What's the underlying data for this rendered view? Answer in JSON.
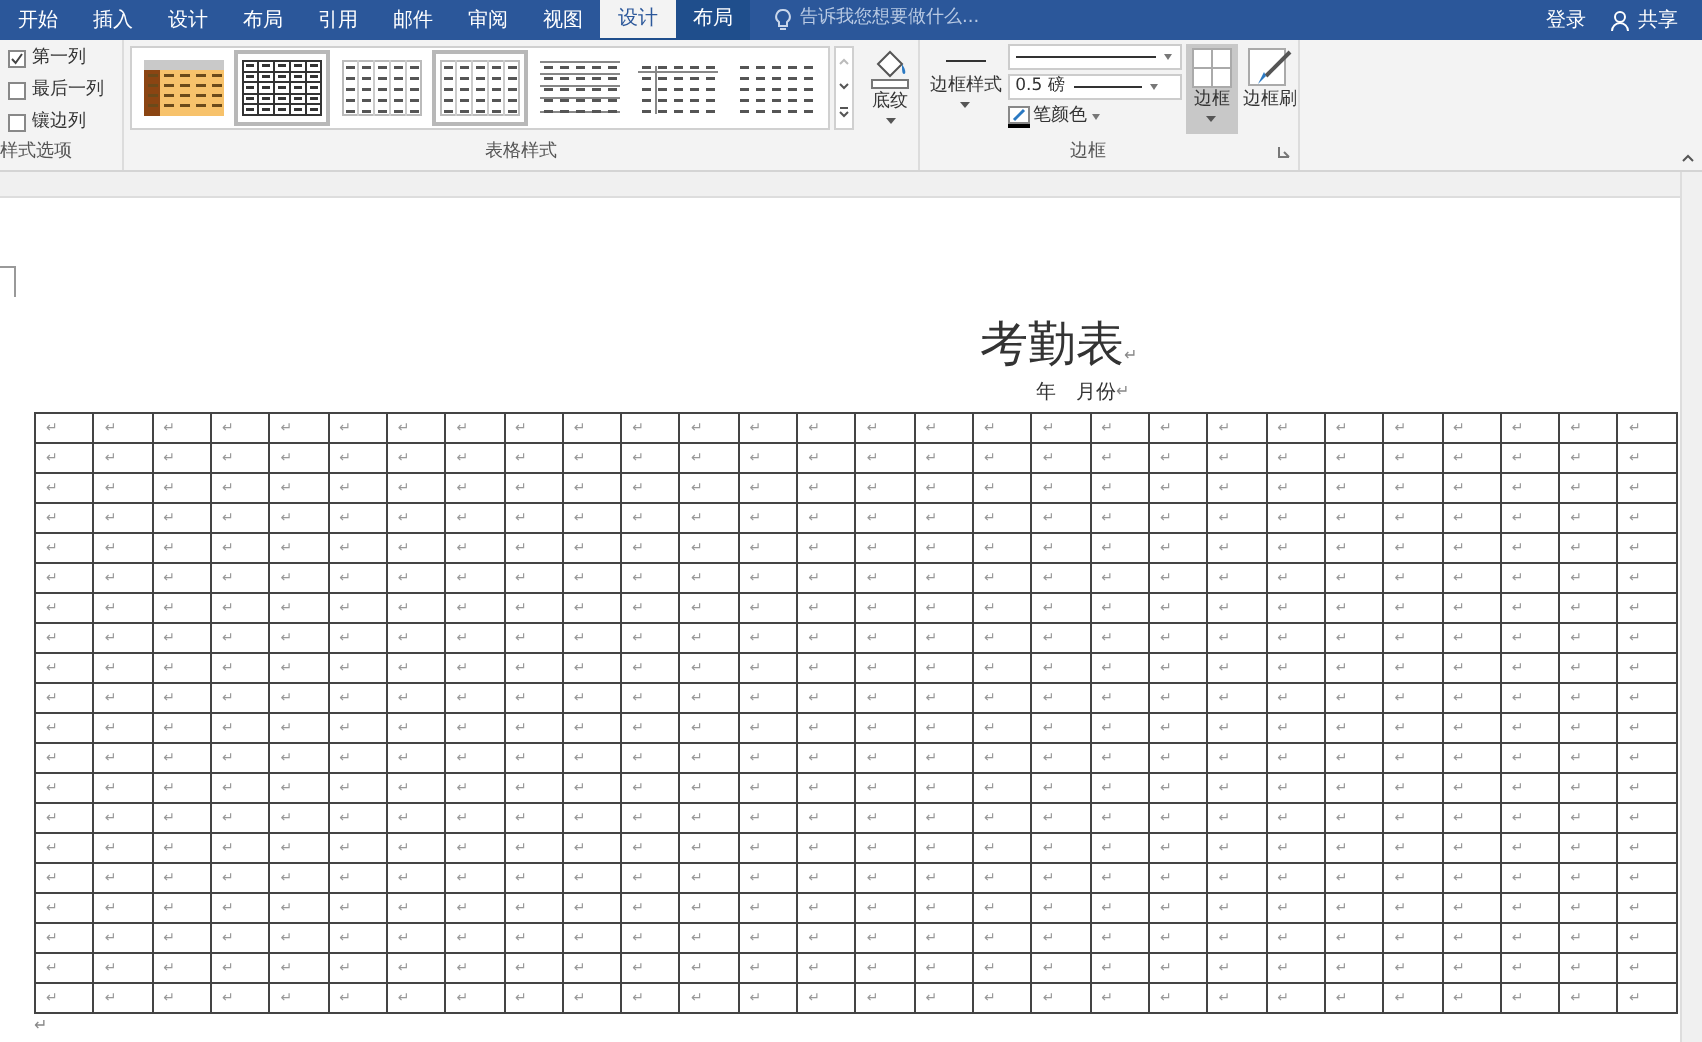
{
  "tabs": [
    {
      "label": "开始",
      "selected": false,
      "kind": "main"
    },
    {
      "label": "插入",
      "selected": false,
      "kind": "main"
    },
    {
      "label": "设计",
      "selected": false,
      "kind": "main"
    },
    {
      "label": "布局",
      "selected": false,
      "kind": "main"
    },
    {
      "label": "引用",
      "selected": false,
      "kind": "main"
    },
    {
      "label": "邮件",
      "selected": false,
      "kind": "main"
    },
    {
      "label": "审阅",
      "selected": false,
      "kind": "main"
    },
    {
      "label": "视图",
      "selected": false,
      "kind": "main"
    },
    {
      "label": "设计",
      "selected": true,
      "kind": "context"
    },
    {
      "label": "布局",
      "selected": false,
      "kind": "context"
    }
  ],
  "search": {
    "placeholder": "告诉我您想要做什么..."
  },
  "account": {
    "sign_in": "登录",
    "share": "共享"
  },
  "ribbon": {
    "options": {
      "items": [
        {
          "label": "第一列",
          "checked": true
        },
        {
          "label": "最后一列",
          "checked": false
        },
        {
          "label": "镶边列",
          "checked": false
        }
      ],
      "group_label": "样式选项"
    },
    "styles": {
      "items": [
        {
          "kind": "colored",
          "selected": false
        },
        {
          "kind": "grid",
          "selected": true
        },
        {
          "kind": "plain",
          "selected": false
        },
        {
          "kind": "plain",
          "selected": true
        },
        {
          "kind": "lines",
          "selected": false
        },
        {
          "kind": "split",
          "selected": false
        },
        {
          "kind": "dashes",
          "selected": false
        }
      ],
      "shading": "底纹",
      "group_label": "表格样式"
    },
    "borders": {
      "border_styles": "边框样式",
      "line_weight": "0.5 磅",
      "pen_color": "笔颜色",
      "border_button": {
        "label": "边框",
        "selected": true
      },
      "border_painter": "边框刷",
      "group_label": "边框"
    }
  },
  "document": {
    "title": "考勤表",
    "title_mark": "↵",
    "subtitle": "年　月份",
    "subtitle_mark": "↵",
    "end_mark": "↵",
    "table": {
      "rows": [
        [
          "↵",
          "↵",
          "↵",
          "↵",
          "↵",
          "↵",
          "↵",
          "↵",
          "↵",
          "↵",
          "↵",
          "↵",
          "↵",
          "↵",
          "↵",
          "↵",
          "↵",
          "↵",
          "↵",
          "↵",
          "↵",
          "↵",
          "↵",
          "↵",
          "↵",
          "↵",
          "↵",
          "↵"
        ],
        [
          "↵",
          "↵",
          "↵",
          "↵",
          "↵",
          "↵",
          "↵",
          "↵",
          "↵",
          "↵",
          "↵",
          "↵",
          "↵",
          "↵",
          "↵",
          "↵",
          "↵",
          "↵",
          "↵",
          "↵",
          "↵",
          "↵",
          "↵",
          "↵",
          "↵",
          "↵",
          "↵",
          "↵"
        ],
        [
          "↵",
          "↵",
          "↵",
          "↵",
          "↵",
          "↵",
          "↵",
          "↵",
          "↵",
          "↵",
          "↵",
          "↵",
          "↵",
          "↵",
          "↵",
          "↵",
          "↵",
          "↵",
          "↵",
          "↵",
          "↵",
          "↵",
          "↵",
          "↵",
          "↵",
          "↵",
          "↵",
          "↵"
        ],
        [
          "↵",
          "↵",
          "↵",
          "↵",
          "↵",
          "↵",
          "↵",
          "↵",
          "↵",
          "↵",
          "↵",
          "↵",
          "↵",
          "↵",
          "↵",
          "↵",
          "↵",
          "↵",
          "↵",
          "↵",
          "↵",
          "↵",
          "↵",
          "↵",
          "↵",
          "↵",
          "↵",
          "↵"
        ],
        [
          "↵",
          "↵",
          "↵",
          "↵",
          "↵",
          "↵",
          "↵",
          "↵",
          "↵",
          "↵",
          "↵",
          "↵",
          "↵",
          "↵",
          "↵",
          "↵",
          "↵",
          "↵",
          "↵",
          "↵",
          "↵",
          "↵",
          "↵",
          "↵",
          "↵",
          "↵",
          "↵",
          "↵"
        ],
        [
          "↵",
          "↵",
          "↵",
          "↵",
          "↵",
          "↵",
          "↵",
          "↵",
          "↵",
          "↵",
          "↵",
          "↵",
          "↵",
          "↵",
          "↵",
          "↵",
          "↵",
          "↵",
          "↵",
          "↵",
          "↵",
          "↵",
          "↵",
          "↵",
          "↵",
          "↵",
          "↵",
          "↵"
        ],
        [
          "↵",
          "↵",
          "↵",
          "↵",
          "↵",
          "↵",
          "↵",
          "↵",
          "↵",
          "↵",
          "↵",
          "↵",
          "↵",
          "↵",
          "↵",
          "↵",
          "↵",
          "↵",
          "↵",
          "↵",
          "↵",
          "↵",
          "↵",
          "↵",
          "↵",
          "↵",
          "↵",
          "↵"
        ],
        [
          "↵",
          "↵",
          "↵",
          "↵",
          "↵",
          "↵",
          "↵",
          "↵",
          "↵",
          "↵",
          "↵",
          "↵",
          "↵",
          "↵",
          "↵",
          "↵",
          "↵",
          "↵",
          "↵",
          "↵",
          "↵",
          "↵",
          "↵",
          "↵",
          "↵",
          "↵",
          "↵",
          "↵"
        ],
        [
          "↵",
          "↵",
          "↵",
          "↵",
          "↵",
          "↵",
          "↵",
          "↵",
          "↵",
          "↵",
          "↵",
          "↵",
          "↵",
          "↵",
          "↵",
          "↵",
          "↵",
          "↵",
          "↵",
          "↵",
          "↵",
          "↵",
          "↵",
          "↵",
          "↵",
          "↵",
          "↵",
          "↵"
        ],
        [
          "↵",
          "↵",
          "↵",
          "↵",
          "↵",
          "↵",
          "↵",
          "↵",
          "↵",
          "↵",
          "↵",
          "↵",
          "↵",
          "↵",
          "↵",
          "↵",
          "↵",
          "↵",
          "↵",
          "↵",
          "↵",
          "↵",
          "↵",
          "↵",
          "↵",
          "↵",
          "↵",
          "↵"
        ],
        [
          "↵",
          "↵",
          "↵",
          "↵",
          "↵",
          "↵",
          "↵",
          "↵",
          "↵",
          "↵",
          "↵",
          "↵",
          "↵",
          "↵",
          "↵",
          "↵",
          "↵",
          "↵",
          "↵",
          "↵",
          "↵",
          "↵",
          "↵",
          "↵",
          "↵",
          "↵",
          "↵",
          "↵"
        ],
        [
          "↵",
          "↵",
          "↵",
          "↵",
          "↵",
          "↵",
          "↵",
          "↵",
          "↵",
          "↵",
          "↵",
          "↵",
          "↵",
          "↵",
          "↵",
          "↵",
          "↵",
          "↵",
          "↵",
          "↵",
          "↵",
          "↵",
          "↵",
          "↵",
          "↵",
          "↵",
          "↵",
          "↵"
        ],
        [
          "↵",
          "↵",
          "↵",
          "↵",
          "↵",
          "↵",
          "↵",
          "↵",
          "↵",
          "↵",
          "↵",
          "↵",
          "↵",
          "↵",
          "↵",
          "↵",
          "↵",
          "↵",
          "↵",
          "↵",
          "↵",
          "↵",
          "↵",
          "↵",
          "↵",
          "↵",
          "↵",
          "↵"
        ],
        [
          "↵",
          "↵",
          "↵",
          "↵",
          "↵",
          "↵",
          "↵",
          "↵",
          "↵",
          "↵",
          "↵",
          "↵",
          "↵",
          "↵",
          "↵",
          "↵",
          "↵",
          "↵",
          "↵",
          "↵",
          "↵",
          "↵",
          "↵",
          "↵",
          "↵",
          "↵",
          "↵",
          "↵"
        ],
        [
          "↵",
          "↵",
          "↵",
          "↵",
          "↵",
          "↵",
          "↵",
          "↵",
          "↵",
          "↵",
          "↵",
          "↵",
          "↵",
          "↵",
          "↵",
          "↵",
          "↵",
          "↵",
          "↵",
          "↵",
          "↵",
          "↵",
          "↵",
          "↵",
          "↵",
          "↵",
          "↵",
          "↵"
        ],
        [
          "↵",
          "↵",
          "↵",
          "↵",
          "↵",
          "↵",
          "↵",
          "↵",
          "↵",
          "↵",
          "↵",
          "↵",
          "↵",
          "↵",
          "↵",
          "↵",
          "↵",
          "↵",
          "↵",
          "↵",
          "↵",
          "↵",
          "↵",
          "↵",
          "↵",
          "↵",
          "↵",
          "↵"
        ],
        [
          "↵",
          "↵",
          "↵",
          "↵",
          "↵",
          "↵",
          "↵",
          "↵",
          "↵",
          "↵",
          "↵",
          "↵",
          "↵",
          "↵",
          "↵",
          "↵",
          "↵",
          "↵",
          "↵",
          "↵",
          "↵",
          "↵",
          "↵",
          "↵",
          "↵",
          "↵",
          "↵",
          "↵"
        ],
        [
          "↵",
          "↵",
          "↵",
          "↵",
          "↵",
          "↵",
          "↵",
          "↵",
          "↵",
          "↵",
          "↵",
          "↵",
          "↵",
          "↵",
          "↵",
          "↵",
          "↵",
          "↵",
          "↵",
          "↵",
          "↵",
          "↵",
          "↵",
          "↵",
          "↵",
          "↵",
          "↵",
          "↵"
        ],
        [
          "↵",
          "↵",
          "↵",
          "↵",
          "↵",
          "↵",
          "↵",
          "↵",
          "↵",
          "↵",
          "↵",
          "↵",
          "↵",
          "↵",
          "↵",
          "↵",
          "↵",
          "↵",
          "↵",
          "↵",
          "↵",
          "↵",
          "↵",
          "↵",
          "↵",
          "↵",
          "↵",
          "↵"
        ],
        [
          "↵",
          "↵",
          "↵",
          "↵",
          "↵",
          "↵",
          "↵",
          "↵",
          "↵",
          "↵",
          "↵",
          "↵",
          "↵",
          "↵",
          "↵",
          "↵",
          "↵",
          "↵",
          "↵",
          "↵",
          "↵",
          "↵",
          "↵",
          "↵",
          "↵",
          "↵",
          "↵",
          "↵"
        ]
      ]
    }
  }
}
